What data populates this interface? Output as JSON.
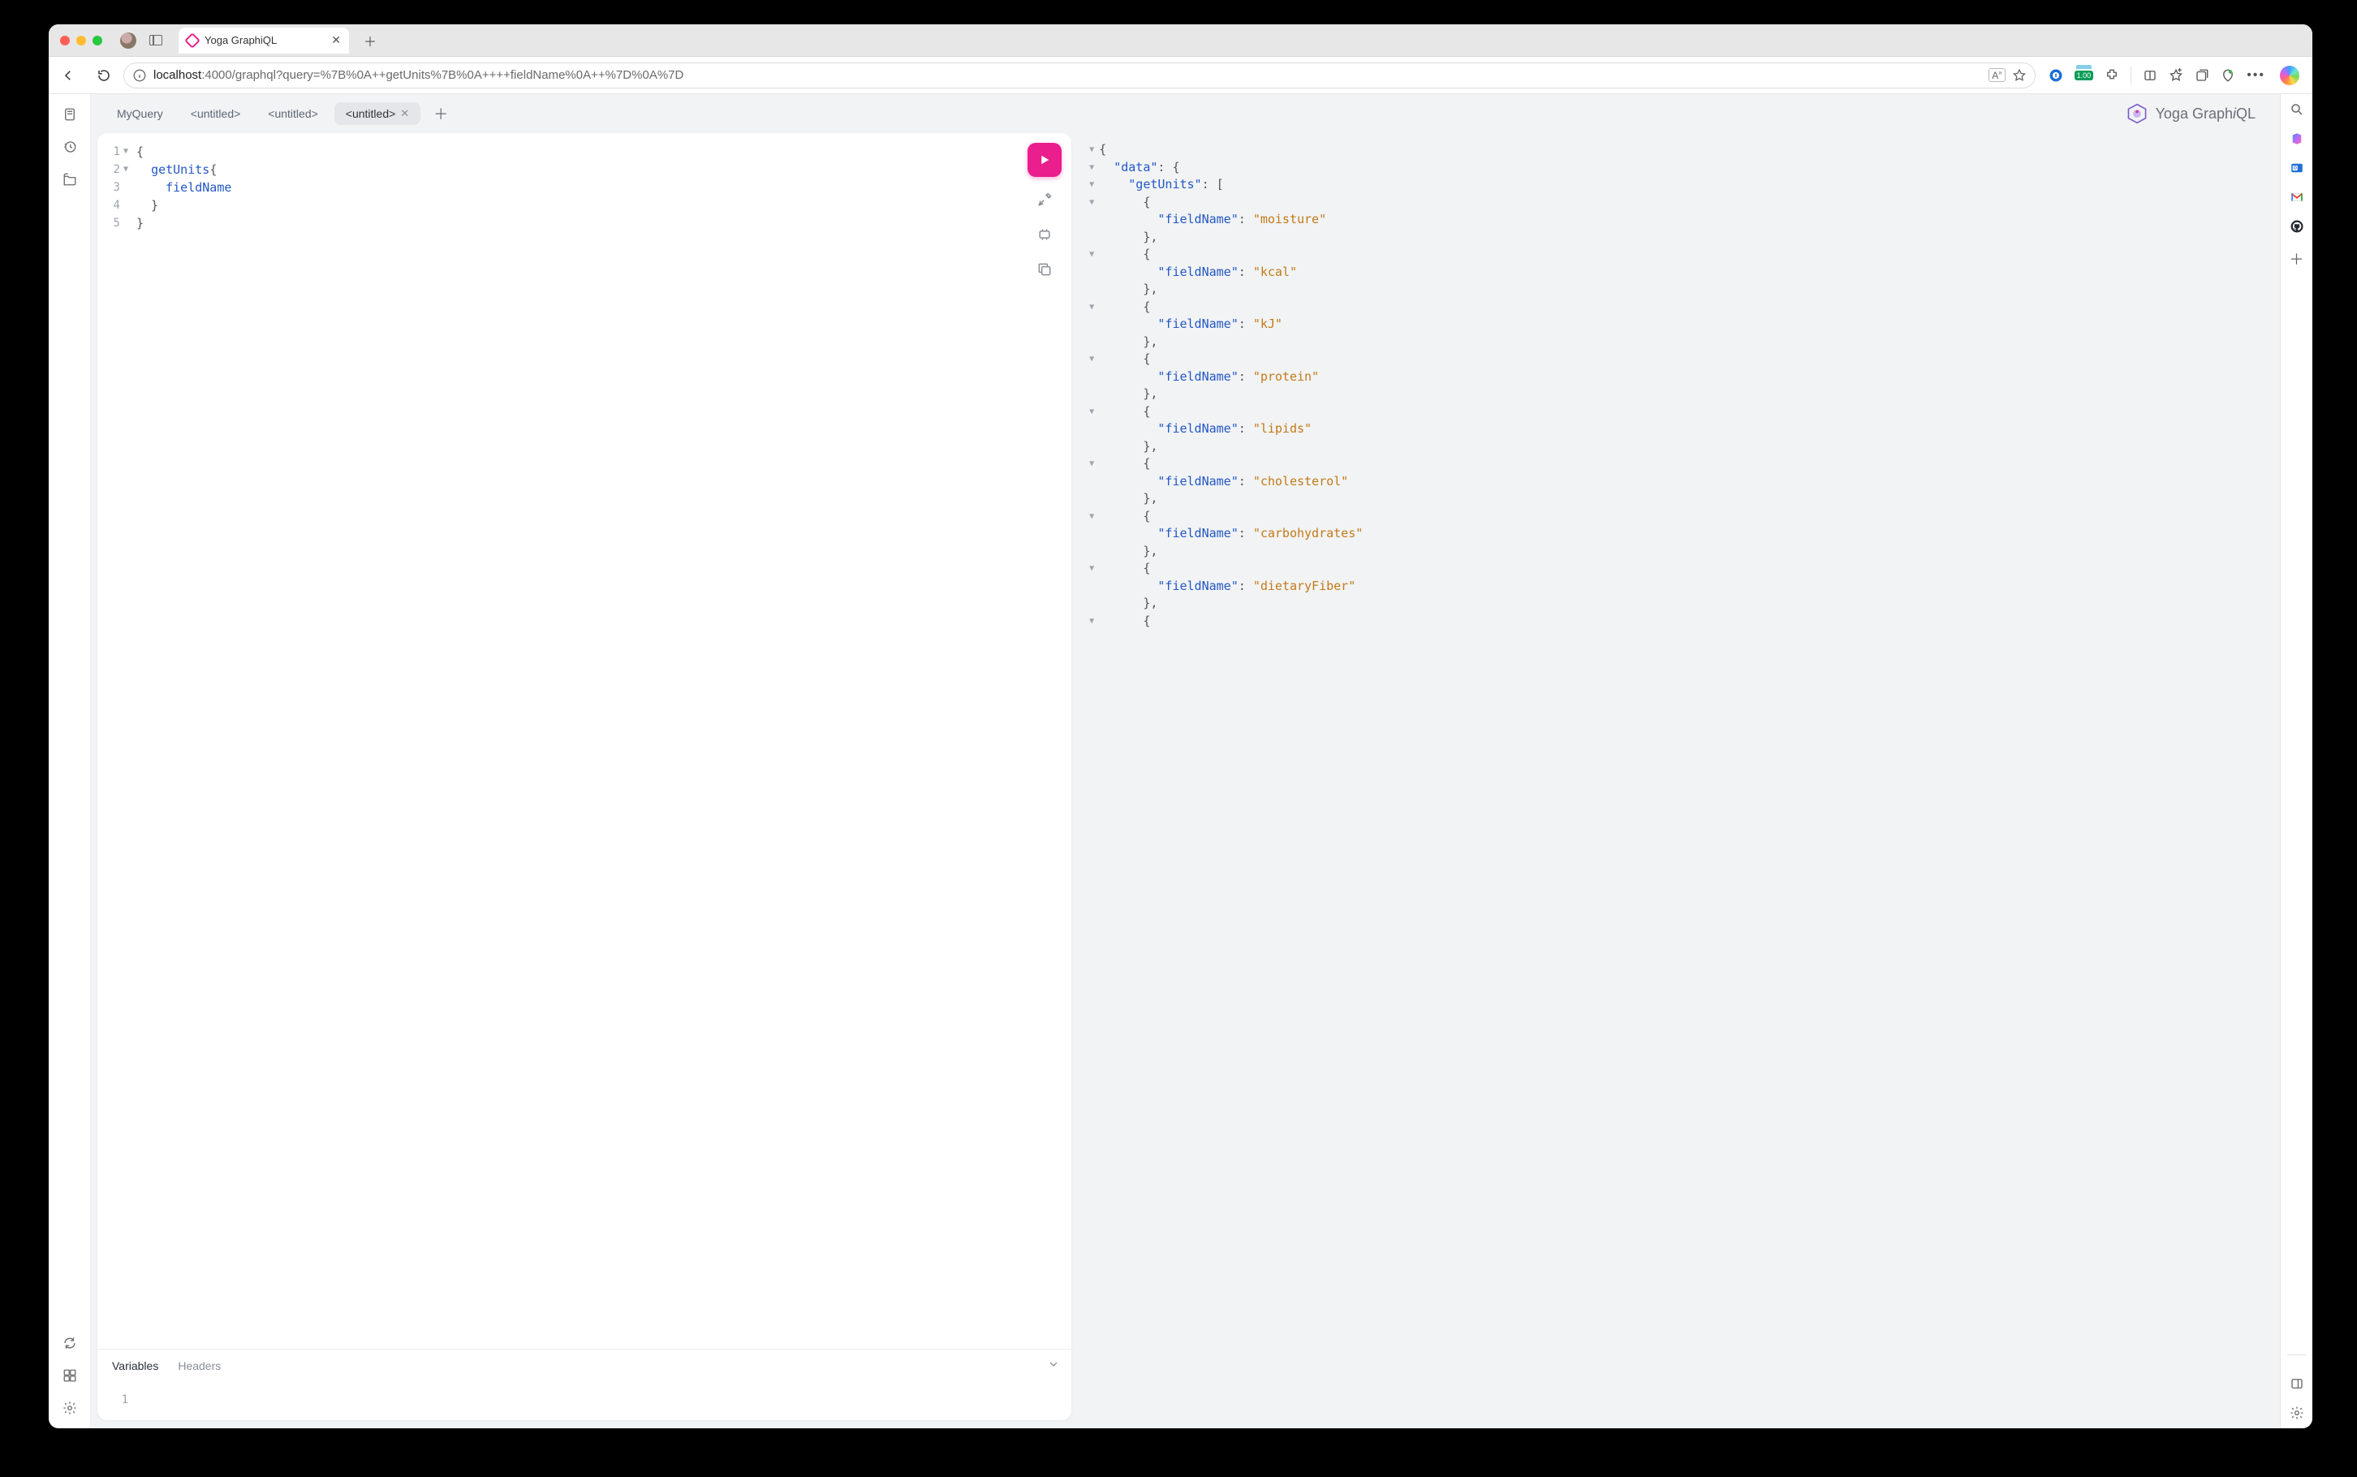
{
  "browser": {
    "tab_title": "Yoga GraphiQL",
    "url_host": "localhost",
    "url_rest": ":4000/graphql?query=%7B%0A++getUnits%7B%0A++++fieldName%0A++%7D%0A%7D",
    "ext_badge": "1.00"
  },
  "graphiql": {
    "tabs": [
      "MyQuery",
      "<untitled>",
      "<untitled>",
      "<untitled>"
    ],
    "active_tab_index": 3,
    "brand_text": "Yoga GraphiQL",
    "query": {
      "lines": [
        {
          "n": "1",
          "fold": "▼",
          "code": [
            {
              "t": "{",
              "cls": "c-brace"
            }
          ]
        },
        {
          "n": "2",
          "fold": "▼",
          "code": [
            {
              "t": "  ",
              "cls": ""
            },
            {
              "t": "getUnits",
              "cls": "c-field"
            },
            {
              "t": "{",
              "cls": "c-brace"
            }
          ]
        },
        {
          "n": "3",
          "fold": "",
          "code": [
            {
              "t": "    ",
              "cls": ""
            },
            {
              "t": "fieldName",
              "cls": "c-field"
            }
          ]
        },
        {
          "n": "4",
          "fold": "",
          "code": [
            {
              "t": "  }",
              "cls": "c-brace"
            }
          ]
        },
        {
          "n": "5",
          "fold": "",
          "code": [
            {
              "t": "}",
              "cls": "c-brace"
            }
          ]
        }
      ]
    },
    "bottom": {
      "variables_label": "Variables",
      "headers_label": "Headers",
      "var_line_no": "1"
    },
    "response": {
      "items": [
        "moisture",
        "kcal",
        "kJ",
        "protein",
        "lipids",
        "cholesterol",
        "carbohydrates",
        "dietaryFiber"
      ],
      "key_data": "\"data\"",
      "key_getUnits": "\"getUnits\"",
      "key_fieldName": "\"fieldName\""
    }
  }
}
